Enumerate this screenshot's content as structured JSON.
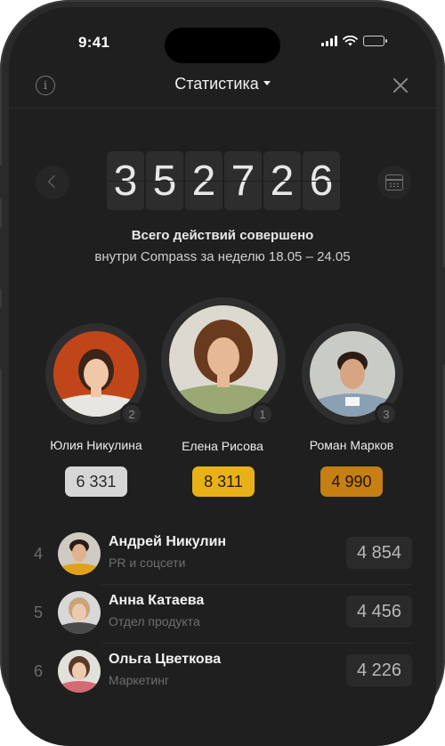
{
  "status_bar": {
    "time": "9:41"
  },
  "header": {
    "title": "Статистика"
  },
  "counter": {
    "digits": [
      "3",
      "5",
      "2",
      "7",
      "2",
      "6"
    ]
  },
  "caption": {
    "line1": "Всего действий совершено",
    "line2": "внутри Compass за неделю 18.05 – 24.05"
  },
  "podium": [
    {
      "rank": "2",
      "name": "Юлия Никулина",
      "score": "6 331",
      "score_bg": "#d6d6d6",
      "score_color": "#2a2a2a"
    },
    {
      "rank": "1",
      "name": "Елена Рисова",
      "score": "8 311",
      "score_bg": "#e9b118",
      "score_color": "#231a00"
    },
    {
      "rank": "3",
      "name": "Роман Марков",
      "score": "4 990",
      "score_bg": "#c57f12",
      "score_color": "#231400"
    }
  ],
  "leaderboard": [
    {
      "rank": "4",
      "name": "Андрей Никулин",
      "dept": "PR и соцсети",
      "score": "4 854"
    },
    {
      "rank": "5",
      "name": "Анна Катаева",
      "dept": "Отдел продукта",
      "score": "4 456"
    },
    {
      "rank": "6",
      "name": "Ольга Цветкова",
      "dept": "Маркетинг",
      "score": "4 226"
    }
  ],
  "colors": {
    "background": "#1f1f1f",
    "gold": "#e9b118",
    "bronze": "#c57f12",
    "silver": "#d6d6d6"
  }
}
